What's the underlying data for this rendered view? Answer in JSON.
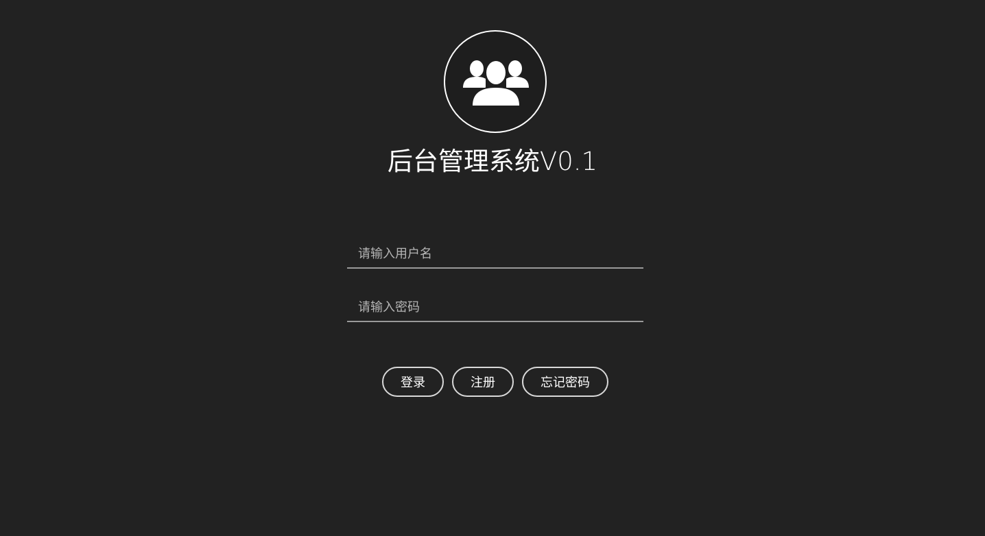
{
  "header": {
    "avatar_icon": "users-group-icon",
    "title": "后台管理系统V0.1"
  },
  "form": {
    "username_placeholder": "请输入用户名",
    "username_value": "",
    "password_placeholder": "请输入密码",
    "password_value": ""
  },
  "buttons": {
    "login_label": "登录",
    "register_label": "注册",
    "forgot_label": "忘记密码"
  },
  "colors": {
    "background": "#222222",
    "foreground": "#ffffff",
    "underline": "#9a9a9a"
  }
}
